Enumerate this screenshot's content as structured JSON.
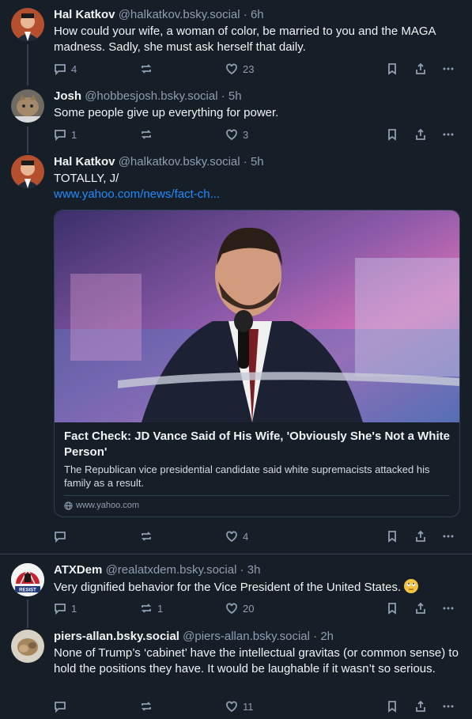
{
  "posts": [
    {
      "author": "Hal Katkov",
      "handle": "@halkatkov.bsky.social",
      "time": "6h",
      "text": "How could your wife, a woman of color, be married to you and the MAGA madness. Sadly, she must ask herself that daily.",
      "replies": "4",
      "reposts": "",
      "likes": "23"
    },
    {
      "author": "Josh",
      "handle": "@hobbesjosh.bsky.social",
      "time": "5h",
      "text": "Some people give up everything for power.",
      "replies": "1",
      "reposts": "",
      "likes": "3"
    },
    {
      "author": "Hal Katkov",
      "handle": "@halkatkov.bsky.social",
      "time": "5h",
      "text": "TOTALLY, J/",
      "link": "www.yahoo.com/news/fact-ch...",
      "card": {
        "title": "Fact Check: JD Vance Said of His Wife, 'Obviously She's Not a White Person'",
        "description": "The Republican vice presidential candidate said white supremacists attacked his family as a result.",
        "source": "www.yahoo.com"
      },
      "replies": "",
      "reposts": "",
      "likes": "4"
    },
    {
      "author": "ATXDem",
      "handle": "@realatxdem.bsky.social",
      "time": "3h",
      "text": "Very dignified behavior for the Vice President of the United States.",
      "replies": "1",
      "reposts": "1",
      "likes": "20"
    },
    {
      "author": "piers-allan.bsky.social",
      "handle": "@piers-allan.bsky.social",
      "time": "2h",
      "text": "None of Trump’s ‘cabinet’ have the intellectual gravitas (or common sense) to hold the positions they have. It would be laughable if it wasn’t so serious.",
      "replies": "",
      "reposts": "",
      "likes": "11"
    }
  ],
  "resist_badge": "RESIST",
  "separator": "·",
  "colors": {
    "background": "#161e27",
    "text": "#f1f3f5",
    "muted": "#8d9fb3",
    "link": "#208bfe",
    "border": "#2e4052"
  }
}
